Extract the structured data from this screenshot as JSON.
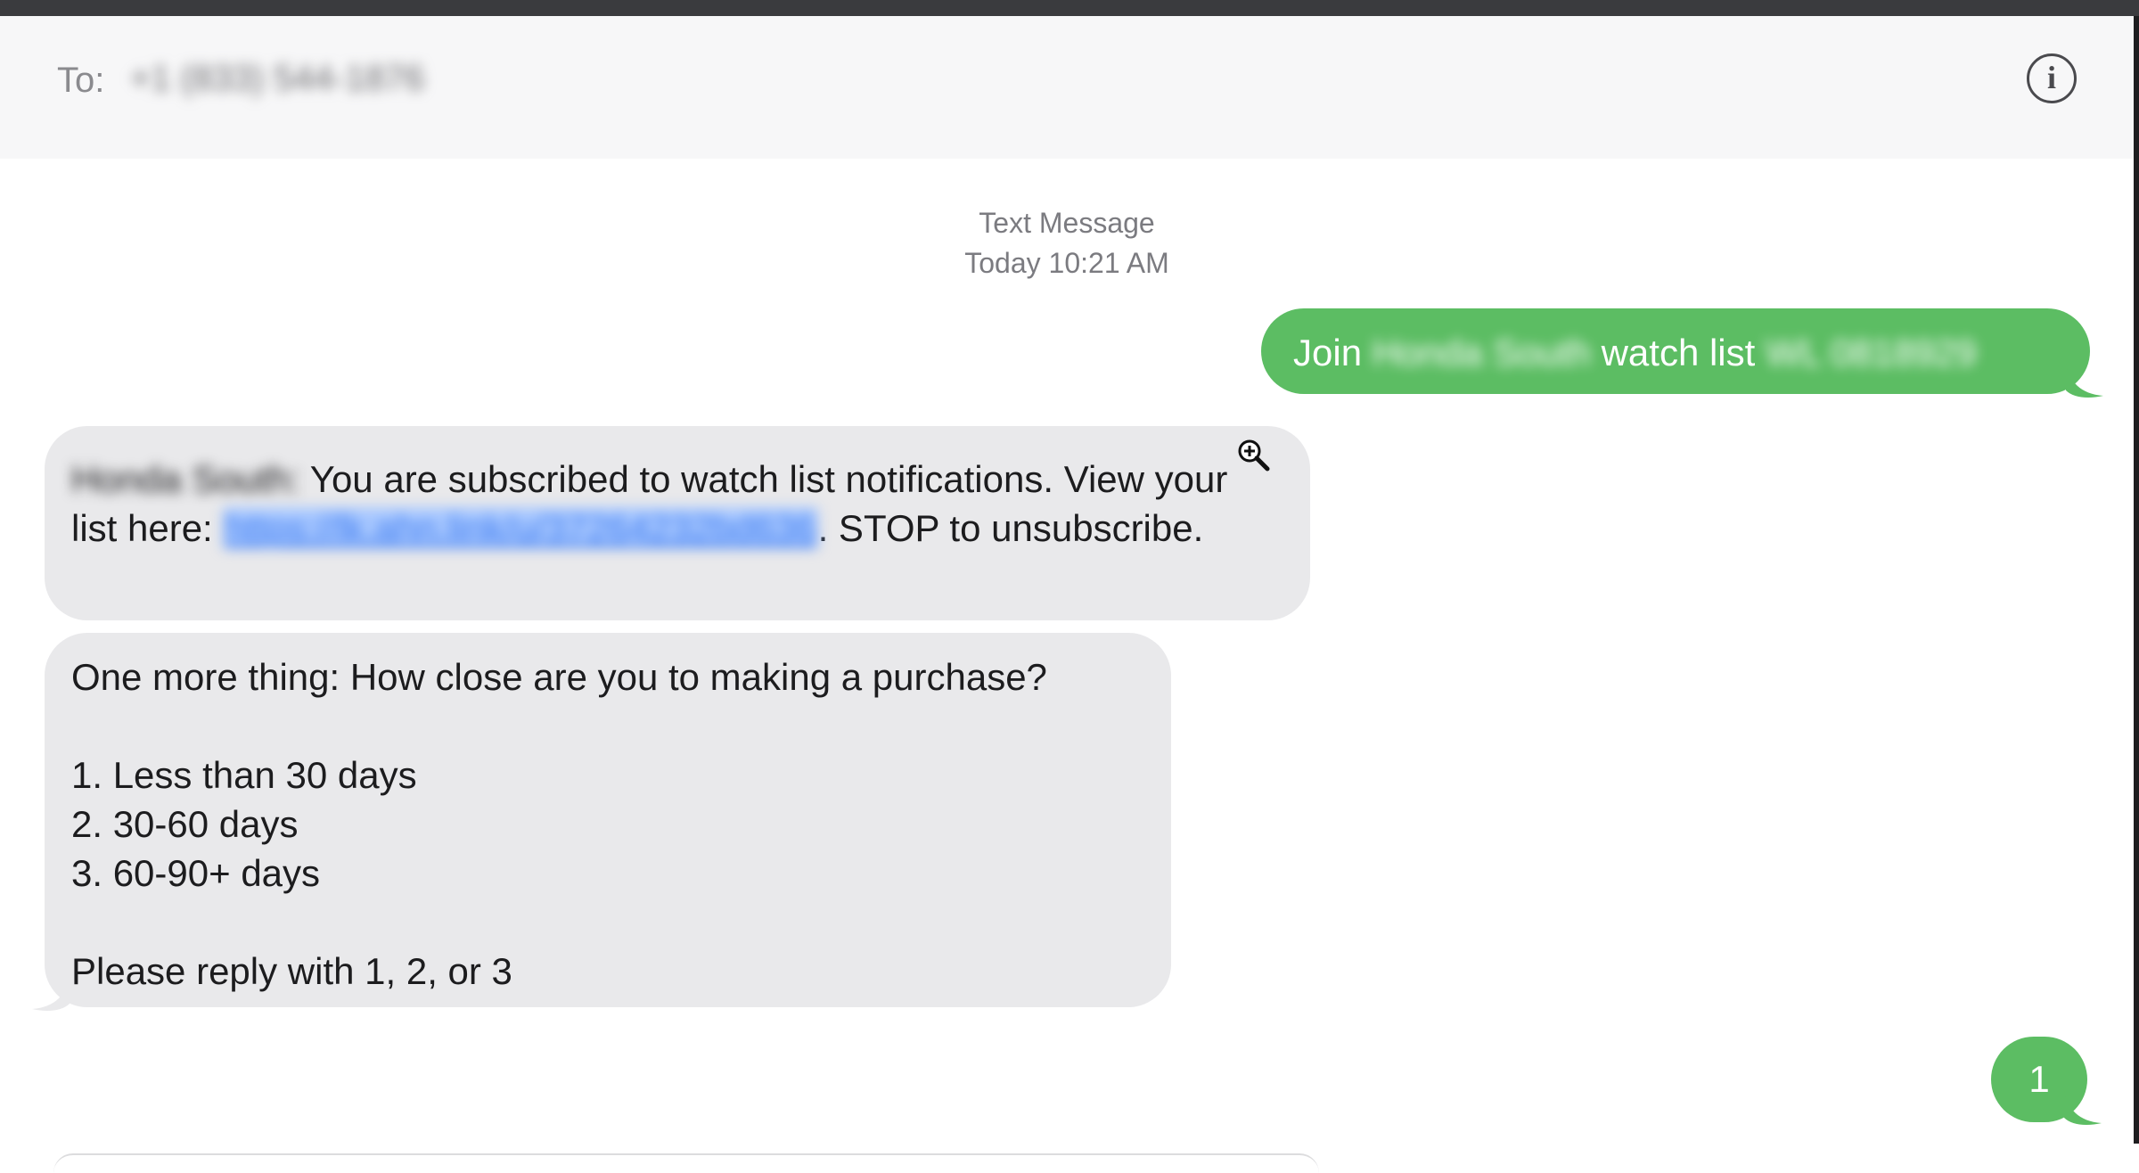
{
  "header": {
    "to_label": "To:",
    "recipient": "+1 (833) 544-1876",
    "info_icon": "info-icon",
    "info_glyph": "i"
  },
  "conversation": {
    "service_label": "Text Message",
    "timestamp": "Today 10:21 AM",
    "messages": [
      {
        "direction": "outgoing",
        "parts": {
          "prefix": "Join ",
          "dealer_blurred": "Honda South",
          "middle": " watch list ",
          "code_blurred": "WL 0818929"
        }
      },
      {
        "direction": "incoming",
        "parts": {
          "sender_blurred": "Honda South:",
          "text1": " You are subscribed to watch list notifications. View your list here: ",
          "link_blurred": "https://lk.ahn.link/u/37264232bd636",
          "text2": ". STOP to unsubscribe."
        }
      },
      {
        "direction": "incoming",
        "text": "One more thing: How close are you to making a purchase?\n\n1. Less than 30 days\n2. 30-60 days\n3. 60-90+ days\n\nPlease reply with 1, 2, or 3"
      },
      {
        "direction": "outgoing",
        "text": "1"
      }
    ]
  },
  "colors": {
    "outgoing_bubble": "#5cbd63",
    "incoming_bubble": "#e9e9eb",
    "link": "#3d7bf0",
    "link_highlight": "#a8c8ff"
  },
  "cursor_icon": "zoom-in-icon"
}
